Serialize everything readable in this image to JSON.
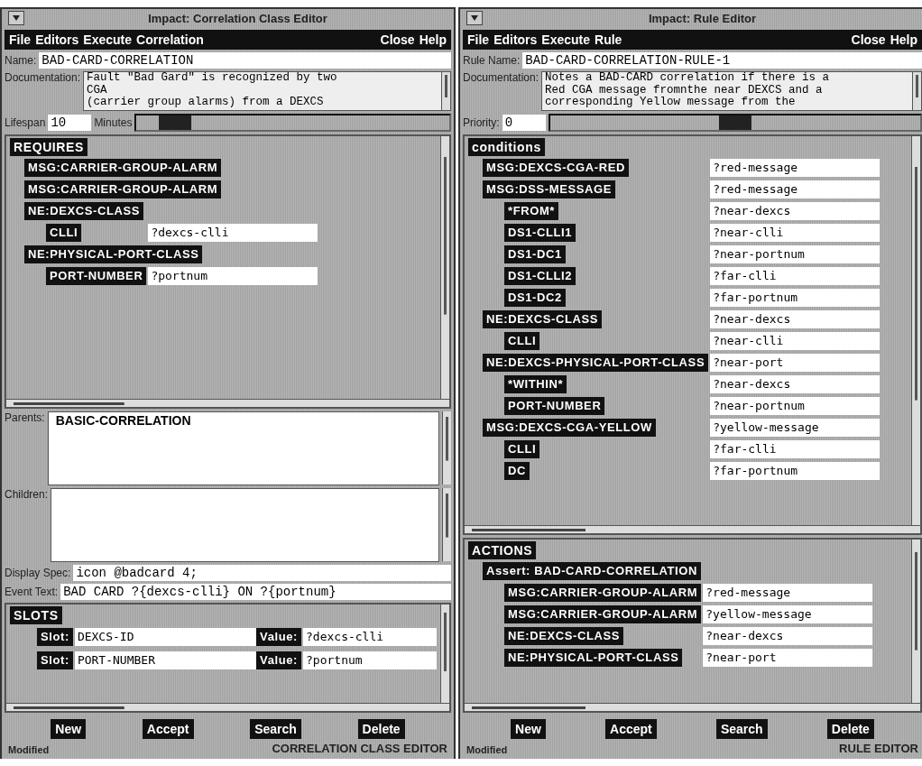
{
  "windows": [
    {
      "title": "Impact: Correlation Class Editor",
      "menu": [
        "File",
        "Editors",
        "Execute",
        "Correlation"
      ],
      "menu_right": [
        "Close",
        "Help"
      ],
      "sections": [
        {
          "kind": "field",
          "label": "Name:",
          "value": "BAD-CARD-CORRELATION"
        },
        {
          "kind": "textarea",
          "label": "Documentation:",
          "lines": [
            "Fault \"Bad Gard\" is recognized by two",
            "CGA",
            "(carrier group alarms) from a DEXCS"
          ]
        },
        {
          "kind": "slider",
          "label": "Lifespan",
          "value": "10",
          "unit": "Minutes",
          "level": 0.08
        },
        {
          "kind": "tree",
          "heading": "REQUIRES",
          "items": [
            {
              "label": "MSG:CARRIER-GROUP-ALARM"
            },
            {
              "label": "MSG:CARRIER-GROUP-ALARM"
            },
            {
              "label": "NE:DEXCS-CLASS",
              "children": [
                {
                  "label": "CLLI",
                  "value": "?dexcs-clli"
                }
              ]
            },
            {
              "label": "NE:PHYSICAL-PORT-CLASS",
              "children": [
                {
                  "label": "PORT-NUMBER",
                  "value": "?portnum"
                }
              ]
            }
          ]
        },
        {
          "kind": "list",
          "label": "Parents:",
          "items": [
            "BASIC-CORRELATION"
          ]
        },
        {
          "kind": "list",
          "label": "Children:"
        },
        {
          "kind": "field",
          "label": "Display Spec:",
          "value": "icon @badcard 4;"
        },
        {
          "kind": "field",
          "label": "Event Text:",
          "value": "BAD CARD ?{dexcs-clli} ON ?{portnum}"
        },
        {
          "kind": "slots",
          "heading": "SLOTS",
          "rows": [
            {
              "slot_label": "Slot:",
              "slot": "DEXCS-ID",
              "value_label": "Value:",
              "value": "?dexcs-clli"
            },
            {
              "slot_label": "Slot:",
              "slot": "PORT-NUMBER",
              "value_label": "Value:",
              "value": "?portnum"
            }
          ]
        }
      ],
      "buttons": [
        "New",
        "Accept",
        "Search",
        "Delete"
      ],
      "status": "Modified",
      "footer": "CORRELATION CLASS EDITOR"
    },
    {
      "title": "Impact: Rule Editor",
      "menu": [
        "File",
        "Editors",
        "Execute",
        "Rule"
      ],
      "menu_right": [
        "Close",
        "Help"
      ],
      "sections": [
        {
          "kind": "field",
          "label": "Rule Name:",
          "value": "BAD-CARD-CORRELATION-RULE-1"
        },
        {
          "kind": "textarea",
          "label": "Documentation:",
          "lines": [
            "Notes a BAD-CARD correlation if there is a",
            "Red CGA message fromnthe near DEXCS and a",
            "corresponding Yellow message from the"
          ]
        },
        {
          "kind": "slider",
          "label": "Priority:",
          "value": "0",
          "level": 0.5
        },
        {
          "kind": "tree",
          "heading": "conditions",
          "items": [
            {
              "label": "MSG:DEXCS-CGA-RED",
              "value": "?red-message"
            },
            {
              "label": "MSG:DSS-MESSAGE",
              "value": "?red-message",
              "children": [
                {
                  "label": "*FROM*",
                  "value": "?near-dexcs"
                },
                {
                  "label": "DS1-CLLI1",
                  "value": "?near-clli"
                },
                {
                  "label": "DS1-DC1",
                  "value": "?near-portnum"
                },
                {
                  "label": "DS1-CLLI2",
                  "value": "?far-clli"
                },
                {
                  "label": "DS1-DC2",
                  "value": "?far-portnum"
                }
              ]
            },
            {
              "label": "NE:DEXCS-CLASS",
              "value": "?near-dexcs",
              "children": [
                {
                  "label": "CLLI",
                  "value": "?near-clli"
                }
              ]
            },
            {
              "label": "NE:DEXCS-PHYSICAL-PORT-CLASS",
              "value": "?near-port",
              "children": [
                {
                  "label": "*WITHIN*",
                  "value": "?near-dexcs"
                },
                {
                  "label": "PORT-NUMBER",
                  "value": "?near-portnum"
                }
              ]
            },
            {
              "label": "MSG:DEXCS-CGA-YELLOW",
              "value": "?yellow-message",
              "children": [
                {
                  "label": "CLLI",
                  "value": "?far-clli"
                },
                {
                  "label": "DC",
                  "value": "?far-portnum"
                }
              ]
            }
          ]
        },
        {
          "kind": "tree",
          "heading": "ACTIONS",
          "items": [
            {
              "label": "Assert: BAD-CARD-CORRELATION",
              "children": [
                {
                  "label": "MSG:CARRIER-GROUP-ALARM",
                  "value": "?red-message"
                },
                {
                  "label": "MSG:CARRIER-GROUP-ALARM",
                  "value": "?yellow-message"
                },
                {
                  "label": "NE:DEXCS-CLASS",
                  "value": "?near-dexcs"
                },
                {
                  "label": "NE:PHYSICAL-PORT-CLASS",
                  "value": "?near-port"
                }
              ]
            }
          ]
        }
      ],
      "buttons": [
        "New",
        "Accept",
        "Search",
        "Delete"
      ],
      "status": "Modified",
      "footer": "RULE EDITOR"
    }
  ]
}
